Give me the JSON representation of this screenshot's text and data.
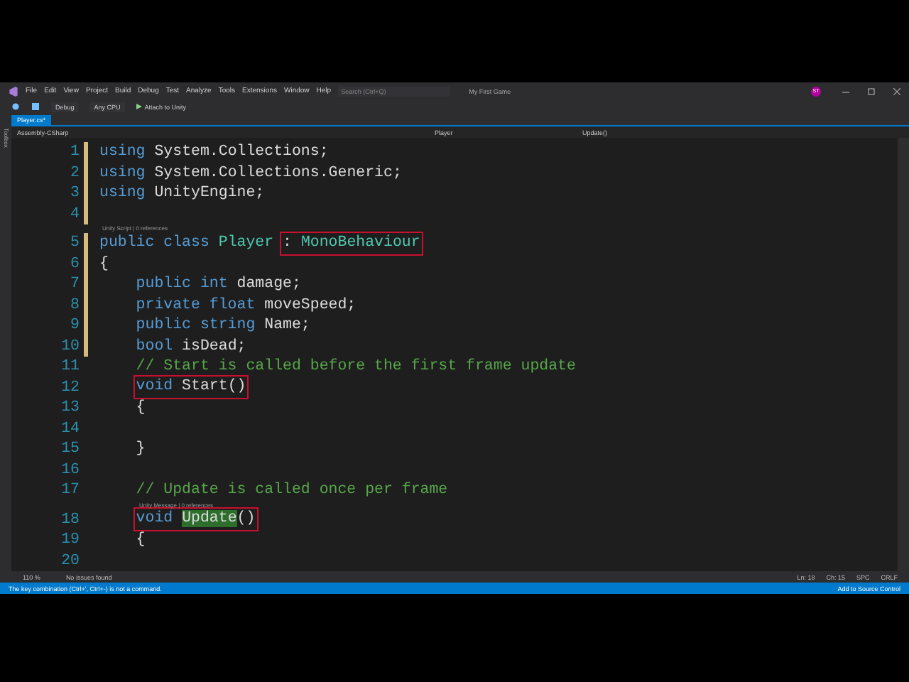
{
  "menu": [
    "File",
    "Edit",
    "View",
    "Project",
    "Build",
    "Debug",
    "Test",
    "Analyze",
    "Tools",
    "Extensions",
    "Window",
    "Help"
  ],
  "search": {
    "placeholder": "Search (Ctrl+Q)"
  },
  "solution": "My First Game",
  "avatar": "ST",
  "toolbar": {
    "configuration": "Debug",
    "platform": "Any CPU",
    "run": "Attach to Unity"
  },
  "side_tab": "Toolbox",
  "tabs": [
    {
      "label": "Player.cs*",
      "selected": true
    }
  ],
  "nav": {
    "project": "Assembly-CSharp",
    "class": "Player",
    "member": "Update()"
  },
  "lines": [
    {
      "number": "1",
      "changed": true,
      "indented": false,
      "segments": [
        {
          "kind": "keyword",
          "text": "using"
        },
        {
          "kind": "plain",
          "text": " System.Collections;"
        }
      ]
    },
    {
      "number": "2",
      "changed": true,
      "indented": false,
      "segments": [
        {
          "kind": "keyword",
          "text": "using"
        },
        {
          "kind": "plain",
          "text": " System.Collections.Generic;"
        }
      ]
    },
    {
      "number": "3",
      "changed": true,
      "indented": false,
      "segments": [
        {
          "kind": "keyword",
          "text": "using"
        },
        {
          "kind": "plain",
          "text": " UnityEngine;"
        }
      ]
    },
    {
      "number": "4",
      "changed": true
    },
    {
      "number": "5",
      "changed": true,
      "indented": false,
      "codelens": "Unity Script | 0 references",
      "segments": [
        {
          "kind": "keyword",
          "text": "public class"
        },
        {
          "kind": "type",
          "text": " Player"
        },
        {
          "kind": "box",
          "children": [
            {
              "kind": "plain",
              "text": ": "
            },
            {
              "kind": "type",
              "text": "MonoBehaviour"
            }
          ]
        }
      ]
    },
    {
      "number": "6",
      "changed": true,
      "indented": false,
      "segments": [
        {
          "kind": "plain",
          "text": "{"
        }
      ]
    },
    {
      "number": "7",
      "changed": true,
      "indented": true,
      "segments": [
        {
          "kind": "keyword",
          "text": "public int"
        },
        {
          "kind": "plain",
          "text": " damage;"
        }
      ]
    },
    {
      "number": "8",
      "changed": true,
      "indented": true,
      "segments": [
        {
          "kind": "keyword",
          "text": "private float"
        },
        {
          "kind": "plain",
          "text": " moveSpeed;"
        }
      ]
    },
    {
      "number": "9",
      "changed": true,
      "indented": true,
      "segments": [
        {
          "kind": "keyword",
          "text": "public string"
        },
        {
          "kind": "plain",
          "text": " Name;"
        }
      ]
    },
    {
      "number": "10",
      "changed": true,
      "indented": true,
      "segments": [
        {
          "kind": "keyword",
          "text": "bool"
        },
        {
          "kind": "plain",
          "text": " isDead;"
        }
      ]
    },
    {
      "number": "11",
      "changed": false,
      "indented": true,
      "segments": [
        {
          "kind": "comment",
          "text": "// Start is called before the first frame update"
        }
      ]
    },
    {
      "number": "12",
      "changed": false,
      "indented": true,
      "segments": [
        {
          "kind": "box",
          "children": [
            {
              "kind": "keyword",
              "text": "void"
            },
            {
              "kind": "plain",
              "text": " Start()"
            }
          ]
        }
      ]
    },
    {
      "number": "13",
      "changed": false,
      "indented": true,
      "segments": [
        {
          "kind": "plain",
          "text": "{"
        }
      ]
    },
    {
      "number": "14",
      "changed": false
    },
    {
      "number": "15",
      "changed": false,
      "indented": true,
      "segments": [
        {
          "kind": "plain",
          "text": "}"
        }
      ]
    },
    {
      "number": "16",
      "changed": false
    },
    {
      "number": "17",
      "changed": false,
      "indented": true,
      "segments": [
        {
          "kind": "comment",
          "text": "// Update is called once per frame"
        }
      ]
    },
    {
      "number": "18",
      "changed": false,
      "indented": true,
      "codelens": "Unity Message | 0 references",
      "segments": [
        {
          "kind": "box",
          "children": [
            {
              "kind": "keyword",
              "text": "void "
            },
            {
              "kind": "match",
              "text": "Update"
            },
            {
              "kind": "plain",
              "text": "()"
            }
          ]
        }
      ]
    },
    {
      "number": "19",
      "changed": false,
      "indented": true,
      "segments": [
        {
          "kind": "plain",
          "text": "{"
        }
      ]
    },
    {
      "number": "20",
      "changed": false
    }
  ],
  "editor_status": {
    "zoom": "110 %",
    "issues": "No issues found",
    "line": "Ln: 18",
    "column": "Ch: 15",
    "spacing": "SPC",
    "line_ending": "CRLF"
  },
  "status_bar": {
    "message": "The key combination (Ctrl+', Ctrl+-) is not a command.",
    "source_control": "Add to Source Control"
  }
}
